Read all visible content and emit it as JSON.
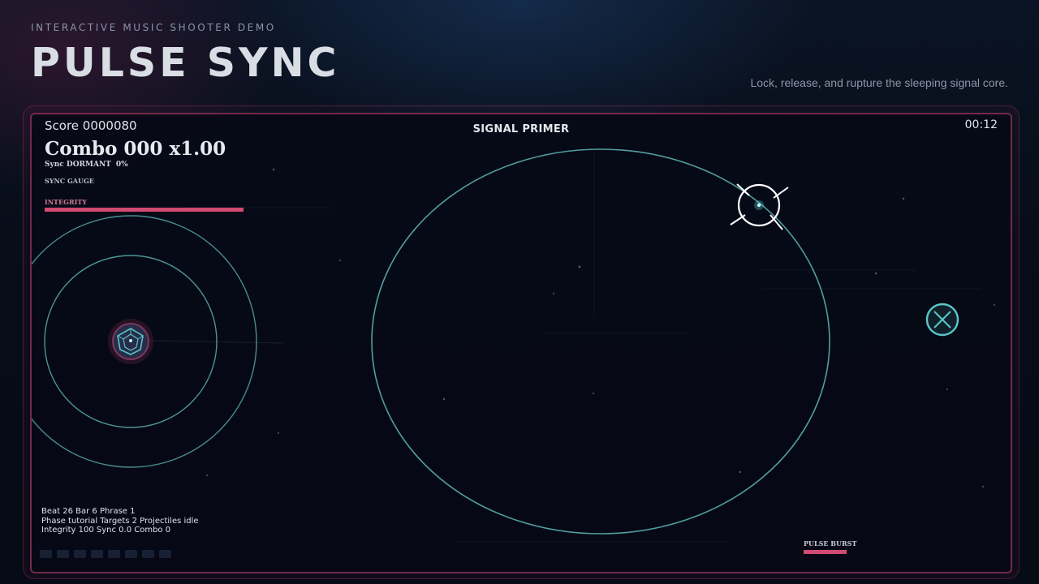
{
  "header": {
    "eyebrow": "INTERACTIVE MUSIC SHOOTER DEMO",
    "title": "PULSE SYNC",
    "tagline": "Lock, release, and rupture the sleeping signal core."
  },
  "hud": {
    "score_text": "Score 0000080",
    "combo_text": "Combo 000",
    "multiplier_text": "x1.00",
    "sync_status_text": "Sync DORMANT",
    "sync_percent_text": "0%",
    "sync_gauge_label": "SYNC GAUGE",
    "sync_level": 0,
    "integrity_label": "INTEGRITY",
    "integrity_level": 1.0,
    "phase_title": "SIGNAL PRIMER",
    "timer": "00:12"
  },
  "debug": {
    "line1": "Beat 26  Bar 6  Phrase 1",
    "line2": "Phase tutorial  Targets 2  Projectiles idle",
    "line3": "Integrity 100  Sync 0.0  Combo 0"
  },
  "beat_track": {
    "cells": 8
  },
  "pulse_burst": {
    "label": "PULSE BURST",
    "level": 1.0
  },
  "colors": {
    "accent_pink": "#d24a72",
    "ring_teal": "#5fb7b8",
    "target_teal": "#58c7c9",
    "frame_pink": "#cd4673"
  },
  "icons": {
    "player_ship": "hexagon-core-icon",
    "reticle": "crosshair-reticle-icon",
    "target": "x-circle-target-icon"
  }
}
